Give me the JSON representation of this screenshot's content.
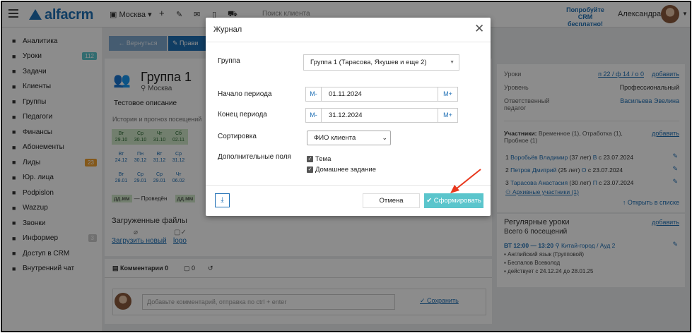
{
  "topbar": {
    "logo": "alfacrm",
    "branch": "Москва ▾",
    "search_placeholder": "Поиск клиента",
    "promo_line1": "Попробуйте",
    "promo_line2": "CRM бесплатно!",
    "user_name": "Александра"
  },
  "sidebar": {
    "items": [
      {
        "label": "Аналитика",
        "icon": "chart-icon"
      },
      {
        "label": "Уроки",
        "icon": "calendar-icon",
        "count": "112",
        "count_color": "#5bc5cc"
      },
      {
        "label": "Задачи",
        "icon": "clipboard-icon"
      },
      {
        "label": "Клиенты",
        "icon": "user-icon"
      },
      {
        "label": "Группы",
        "icon": "users-icon",
        "active": true
      },
      {
        "label": "Педагоги",
        "icon": "graduation-cap-icon"
      },
      {
        "label": "Финансы",
        "icon": "money-icon"
      },
      {
        "label": "Абонементы",
        "icon": "tag-icon"
      },
      {
        "label": "Лиды",
        "icon": "user-plus-icon",
        "count": "23",
        "count_color": "#f0a030"
      },
      {
        "label": "Юр. лица",
        "icon": "building-icon"
      },
      {
        "label": "Podpislon",
        "icon": "document-icon"
      },
      {
        "label": "Wazzup",
        "icon": "whatsapp-icon"
      },
      {
        "label": "Звонки",
        "icon": "phone-icon"
      },
      {
        "label": "Информер",
        "icon": "envelope-icon",
        "count": "3",
        "count_color": "#cccccc"
      },
      {
        "label": "Доступ в CRM",
        "icon": "lock-icon"
      },
      {
        "label": "Внутренний чат",
        "icon": "chat-icon"
      }
    ]
  },
  "group": {
    "back_label": "← Вернуться",
    "edit_label": "Прави",
    "title": "Группа 1",
    "city": "Москва",
    "description": "Тестовое описание",
    "history_label": "История и прогноз посещений",
    "legend_code": "дд.мм",
    "legend_text": "— Проведён",
    "legend_code2": "дд.мм",
    "calendar": [
      {
        "d": "Вт",
        "dt": "29.10",
        "g": true
      },
      {
        "d": "Ср",
        "dt": "30.10",
        "g": true
      },
      {
        "d": "Чт",
        "dt": "31.10",
        "g": true
      },
      {
        "d": "Сб",
        "dt": "02.11",
        "g": true
      },
      {
        "d": "Вт",
        "dt": "24.12",
        "g": false
      },
      {
        "d": "Пн",
        "dt": "30.12",
        "g": false
      },
      {
        "d": "Вт",
        "dt": "31.12",
        "g": false
      },
      {
        "d": "Ср",
        "dt": "31.12",
        "g": false
      },
      {
        "d": "Вт",
        "dt": "28.01",
        "g": false
      },
      {
        "d": "Ср",
        "dt": "29.01",
        "g": false
      },
      {
        "d": "Ср",
        "dt": "29.01",
        "g": false
      },
      {
        "d": "Чт",
        "dt": "06.02",
        "g": false
      }
    ],
    "files_title": "Загруженные файлы",
    "upload_label": "Загрузить новый",
    "file_name": "logo"
  },
  "comments": {
    "tab_comments": "Комментарии 0",
    "tab_files": "0",
    "placeholder": "Добавьте комментарий, отправка по ctrl + enter",
    "save_label": "Сохранить"
  },
  "right_panel": {
    "lessons_label": "Уроки",
    "lessons_value": "п 22 / ф 14 / о 0",
    "add_label": "добавить",
    "level_label": "Уровень",
    "level_value": "Профессиональный",
    "responsible_label": "Ответственный педагог",
    "responsible_value": "Васильева Эвелина",
    "participants_label": "Участники:",
    "participants_note": "Временное (1), Отработка (1), Пробное (1)",
    "members": [
      {
        "n": "1",
        "name": "Воробьёв Владимир",
        "age": "(37 лет)",
        "tag": "В",
        "since": "с 23.07.2024"
      },
      {
        "n": "2",
        "name": "Петров Дмитрий",
        "age": "(25 лет)",
        "tag": "О",
        "since": "с 23.07.2024"
      },
      {
        "n": "3",
        "name": "Тарасова Анастасия",
        "age": "(30 лет)",
        "tag": "П",
        "since": "с 23.07.2024"
      }
    ],
    "archive_label": "Архивные участники (1)",
    "open_list": "↑ Открыть в списке",
    "regular_title": "Регулярные уроки",
    "regular_sub": "Всего 6 посещений",
    "reg_time": "ВТ 12:00 — 13:20",
    "reg_place": "Китай-город / Ауд 2",
    "reg_subject": "Английский язык (Групповой)",
    "reg_teacher": "Беспалов Всеволод",
    "reg_period": "действует с 24.12.24 до 28.01.25"
  },
  "modal": {
    "title": "Журнал",
    "group_label": "Группа",
    "group_value": "Группа 1 (Тарасова, Якушев и еще 2)",
    "start_label": "Начало периода",
    "start_value": "01.11.2024",
    "end_label": "Конец периода",
    "end_value": "31.12.2024",
    "minus_label": "M-",
    "plus_label": "M+",
    "sort_label": "Сортировка",
    "sort_value": "ФИО клиента",
    "extra_label": "Дополнительные поля",
    "chk_theme": "Тема",
    "chk_homework": "Домашнее задание",
    "cancel_label": "Отмена",
    "submit_label": "✔ Сформировать"
  },
  "colors": {
    "brand": "#1e6fb5",
    "submit": "#5bc5cc",
    "annotation_arrow": "#e8381e"
  }
}
